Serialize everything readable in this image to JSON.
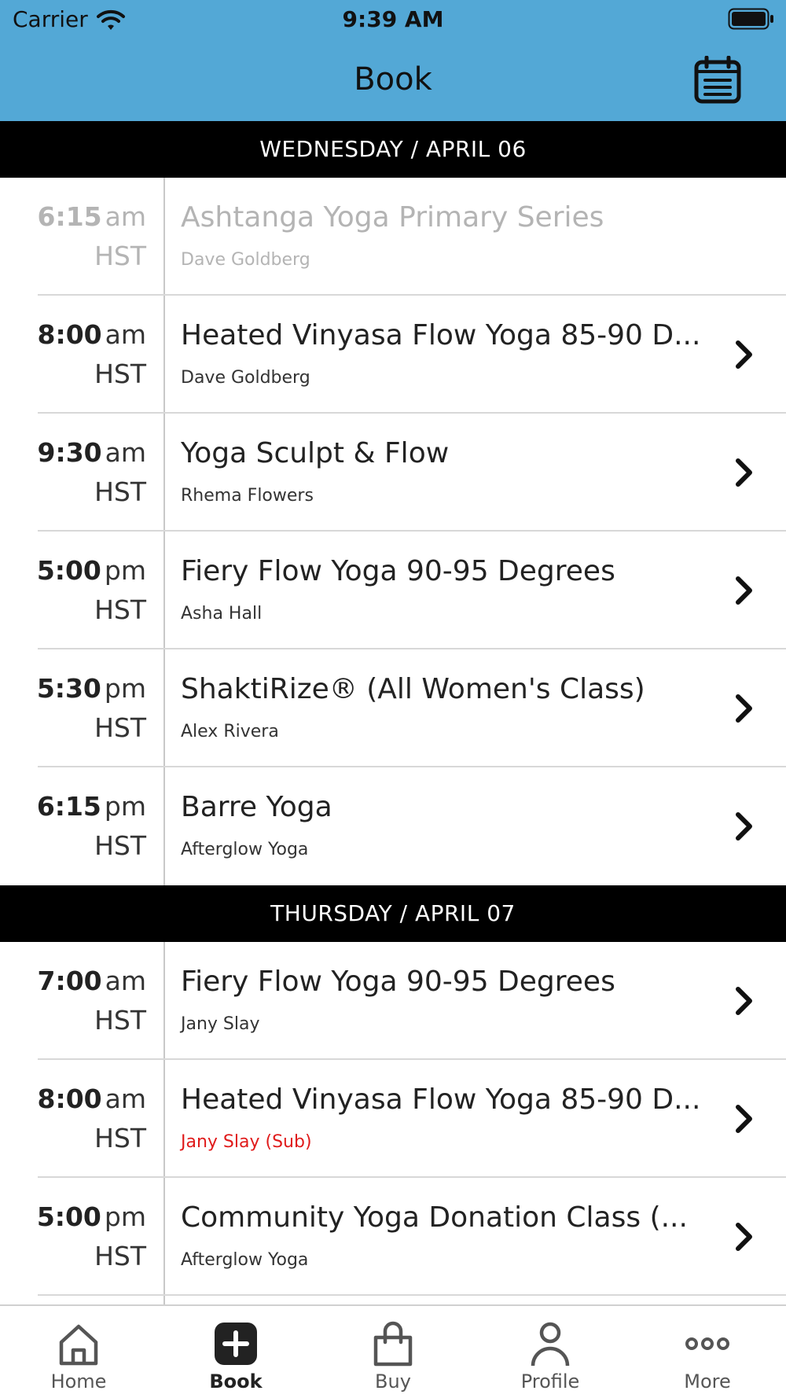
{
  "status_bar": {
    "carrier": "Carrier",
    "time": "9:39 AM",
    "icons": [
      "wifi-icon",
      "battery-icon"
    ]
  },
  "header": {
    "title": "Book",
    "calendar_icon": "calendar-icon",
    "background_color": "#53a8d6"
  },
  "days": [
    {
      "label": "WEDNESDAY / APRIL 06",
      "classes": [
        {
          "time": "6:15",
          "ampm": "am",
          "tz": "HST",
          "name": "Ashtanga Yoga Primary Series",
          "instructor": "Dave Goldberg",
          "past": true,
          "sub": false
        },
        {
          "time": "8:00",
          "ampm": "am",
          "tz": "HST",
          "name": "Heated Vinyasa Flow Yoga 85-90 D...",
          "instructor": "Dave Goldberg",
          "past": false,
          "sub": false
        },
        {
          "time": "9:30",
          "ampm": "am",
          "tz": "HST",
          "name": "Yoga Sculpt & Flow",
          "instructor": "Rhema Flowers",
          "past": false,
          "sub": false
        },
        {
          "time": "5:00",
          "ampm": "pm",
          "tz": "HST",
          "name": "Fiery Flow Yoga 90-95 Degrees",
          "instructor": "Asha Hall",
          "past": false,
          "sub": false
        },
        {
          "time": "5:30",
          "ampm": "pm",
          "tz": "HST",
          "name": "ShaktiRize® (All Women's Class)",
          "instructor": "Alex Rivera",
          "past": false,
          "sub": false
        },
        {
          "time": "6:15",
          "ampm": "pm",
          "tz": "HST",
          "name": "Barre Yoga",
          "instructor": "Afterglow Yoga",
          "past": false,
          "sub": false
        }
      ]
    },
    {
      "label": "THURSDAY / APRIL 07",
      "classes": [
        {
          "time": "7:00",
          "ampm": "am",
          "tz": "HST",
          "name": "Fiery Flow Yoga 90-95 Degrees",
          "instructor": "Jany Slay",
          "past": false,
          "sub": false
        },
        {
          "time": "8:00",
          "ampm": "am",
          "tz": "HST",
          "name": "Heated Vinyasa Flow Yoga 85-90 D...",
          "instructor": "Jany Slay (Sub)",
          "past": false,
          "sub": true
        },
        {
          "time": "5:00",
          "ampm": "pm",
          "tz": "HST",
          "name": "Community Yoga Donation Class (...",
          "instructor": "Afterglow Yoga",
          "past": false,
          "sub": false
        }
      ]
    }
  ],
  "colors": {
    "sub_instructor": "#e01b1b",
    "past_text": "#b4b4b4"
  },
  "tabs": [
    {
      "label": "Home",
      "icon": "home-icon",
      "active": false
    },
    {
      "label": "Book",
      "icon": "plus-square-icon",
      "active": true
    },
    {
      "label": "Buy",
      "icon": "shopping-bag-icon",
      "active": false
    },
    {
      "label": "Profile",
      "icon": "person-icon",
      "active": false
    },
    {
      "label": "More",
      "icon": "more-dots-icon",
      "active": false
    }
  ]
}
